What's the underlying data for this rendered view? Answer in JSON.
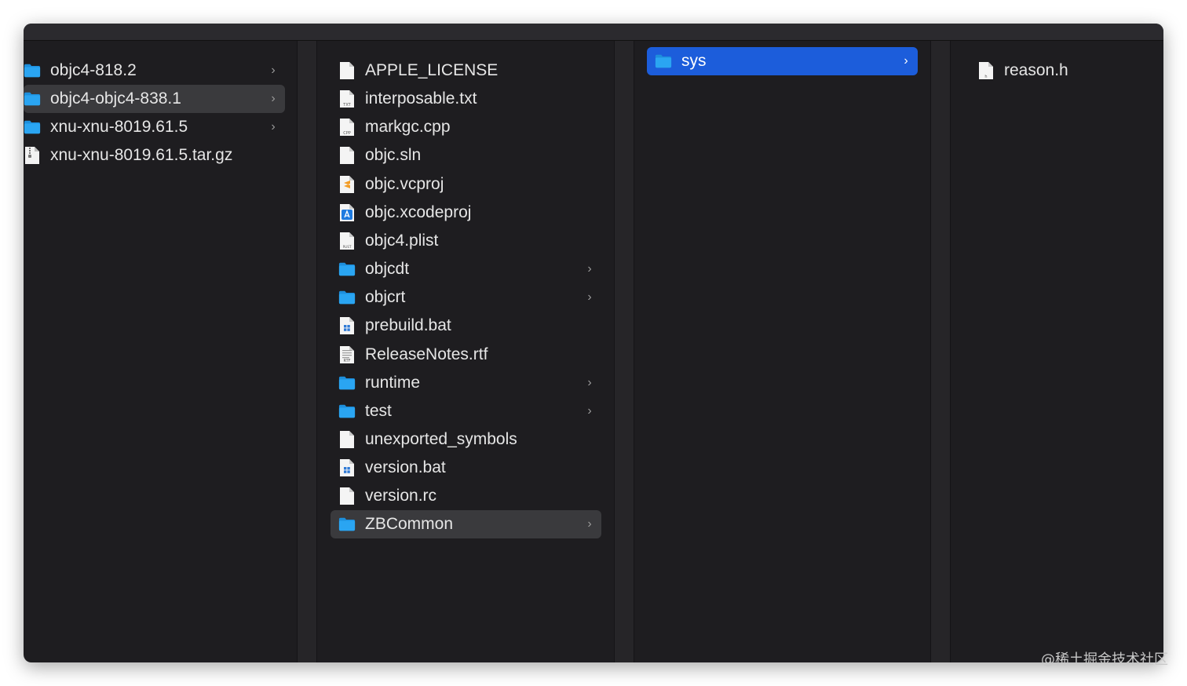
{
  "colors": {
    "window_bg": "#1e1d20",
    "folder": "#2aa5f2",
    "selection_active": "#1c5ddb",
    "selection_inactive": "#3a3a3d"
  },
  "columns": [
    {
      "items": [
        {
          "label": "objc4-818.2",
          "icon": "folder-icon",
          "chevron": true
        },
        {
          "label": "objc4-objc4-838.1",
          "icon": "folder-icon",
          "chevron": true,
          "selected": "inactive"
        },
        {
          "label": "xnu-xnu-8019.61.5",
          "icon": "folder-icon",
          "chevron": true
        },
        {
          "label": "xnu-xnu-8019.61.5.tar.gz",
          "icon": "archive-file-icon",
          "chevron": false
        }
      ]
    },
    {
      "items": [
        {
          "label": "APPLE_LICENSE",
          "icon": "document-icon",
          "chevron": false
        },
        {
          "label": "interposable.txt",
          "icon": "txt-file-icon",
          "badge": "TXT",
          "chevron": false
        },
        {
          "label": "markgc.cpp",
          "icon": "cpp-file-icon",
          "badge": "CPP",
          "chevron": false
        },
        {
          "label": "objc.sln",
          "icon": "document-icon",
          "chevron": false
        },
        {
          "label": "objc.vcproj",
          "icon": "sublime-file-icon",
          "chevron": false
        },
        {
          "label": "objc.xcodeproj",
          "icon": "xcodeproj-icon",
          "chevron": false
        },
        {
          "label": "objc4.plist",
          "icon": "plist-file-icon",
          "badge": "PLIST",
          "chevron": false
        },
        {
          "label": "objcdt",
          "icon": "folder-icon",
          "chevron": true
        },
        {
          "label": "objcrt",
          "icon": "folder-icon",
          "chevron": true
        },
        {
          "label": "prebuild.bat",
          "icon": "bat-file-icon",
          "chevron": false
        },
        {
          "label": "ReleaseNotes.rtf",
          "icon": "rtf-file-icon",
          "badge": "RTF",
          "chevron": false
        },
        {
          "label": "runtime",
          "icon": "folder-icon",
          "chevron": true
        },
        {
          "label": "test",
          "icon": "folder-icon",
          "chevron": true
        },
        {
          "label": "unexported_symbols",
          "icon": "document-icon",
          "chevron": false
        },
        {
          "label": "version.bat",
          "icon": "bat-file-icon",
          "chevron": false
        },
        {
          "label": "version.rc",
          "icon": "document-icon",
          "chevron": false
        },
        {
          "label": "ZBCommon",
          "icon": "folder-icon",
          "chevron": true,
          "selected": "inactive"
        }
      ]
    },
    {
      "items": [
        {
          "label": "sys",
          "icon": "folder-icon",
          "chevron": true,
          "selected": "active"
        }
      ]
    },
    {
      "items": [
        {
          "label": "reason.h",
          "icon": "h-file-icon",
          "badge": "h",
          "chevron": false
        }
      ]
    }
  ],
  "watermark": "@稀土掘金技术社区"
}
